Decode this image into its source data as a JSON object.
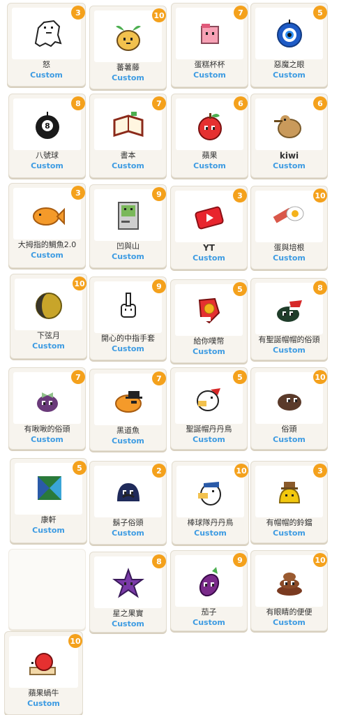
{
  "badge_color": "#f4a11c",
  "link_color": "#3d9be2",
  "stickers": [
    {
      "name": "怒",
      "count": "3",
      "link": "Custom",
      "icon": "angry-ghost-icon"
    },
    {
      "name": "蕃薯藤",
      "count": "10",
      "link": "Custom",
      "icon": "sweet-potato-icon"
    },
    {
      "name": "蛋糕杯杯",
      "count": "7",
      "link": "Custom",
      "icon": "cupcake-icon"
    },
    {
      "name": "惡魔之眼",
      "count": "5",
      "link": "Custom",
      "icon": "evil-eye-icon"
    },
    {
      "name": "八號球",
      "count": "8",
      "link": "Custom",
      "icon": "eight-ball-icon"
    },
    {
      "name": "書本",
      "count": "7",
      "link": "Custom",
      "icon": "book-icon"
    },
    {
      "name": "蘋果",
      "count": "6",
      "link": "Custom",
      "icon": "apple-icon"
    },
    {
      "name": "kiwi",
      "count": "6",
      "link": "Custom",
      "icon": "kiwi-bird-icon"
    },
    {
      "name": "大拇指的鯛魚2.0",
      "count": "3",
      "link": "Custom",
      "icon": "taiyaki-icon"
    },
    {
      "name": "凹與山",
      "count": "9",
      "link": "Custom",
      "icon": "retro-computer-icon"
    },
    {
      "name": "YT",
      "count": "3",
      "link": "Custom",
      "icon": "yt-play-icon"
    },
    {
      "name": "蛋與培根",
      "count": "10",
      "link": "Custom",
      "icon": "egg-bacon-icon"
    },
    {
      "name": "下弦月",
      "count": "10",
      "link": "Custom",
      "icon": "moon-icon"
    },
    {
      "name": "開心的中指手套",
      "count": "9",
      "link": "Custom",
      "icon": "glove-finger-icon"
    },
    {
      "name": "給你噗幣",
      "count": "5",
      "link": "Custom",
      "icon": "mitten-coin-icon"
    },
    {
      "name": "有聖誕帽帽的俗頭",
      "count": "8",
      "link": "Custom",
      "icon": "santa-blob-icon"
    },
    {
      "name": "有啾啾的俗頭",
      "count": "7",
      "link": "Custom",
      "icon": "bow-blob-icon"
    },
    {
      "name": "黑道魚",
      "count": "7",
      "link": "Custom",
      "icon": "gangster-fish-icon"
    },
    {
      "name": "聖誕帽丹丹鳥",
      "count": "5",
      "link": "Custom",
      "icon": "santa-bird-icon"
    },
    {
      "name": "俗頭",
      "count": "10",
      "link": "Custom",
      "icon": "blob-icon"
    },
    {
      "name": "康軒",
      "count": "5",
      "link": "Custom",
      "icon": "kangxuan-logo-icon"
    },
    {
      "name": "鬍子俗頭",
      "count": "2",
      "link": "Custom",
      "icon": "mustache-blob-icon"
    },
    {
      "name": "棒球隊丹丹鳥",
      "count": "10",
      "link": "Custom",
      "icon": "baseball-bird-icon"
    },
    {
      "name": "有帽帽的鈴鐺",
      "count": "3",
      "link": "Custom",
      "icon": "hat-bell-icon"
    },
    {
      "name": "",
      "count": "",
      "link": "",
      "icon": ""
    },
    {
      "name": "星之果實",
      "count": "8",
      "link": "Custom",
      "icon": "star-fruit-icon"
    },
    {
      "name": "茄子",
      "count": "9",
      "link": "Custom",
      "icon": "eggplant-icon"
    },
    {
      "name": "有眼睛的便便",
      "count": "10",
      "link": "Custom",
      "icon": "poop-eyes-icon"
    },
    {
      "name": "蘋果蝸牛",
      "count": "10",
      "link": "Custom",
      "icon": "apple-snail-icon"
    }
  ]
}
